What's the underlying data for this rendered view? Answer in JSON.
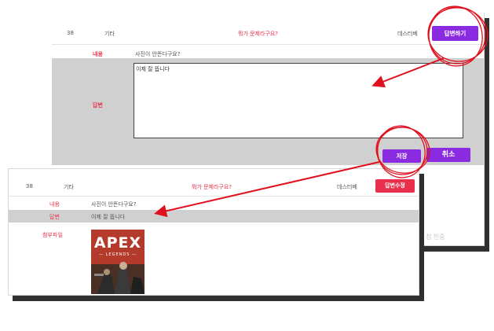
{
  "back_panel": {
    "row": {
      "num": "38",
      "category": "기타",
      "title": "뭐가 문제라구요?",
      "author": "데스터베",
      "answer_button": "답변하기"
    },
    "content_label": "내용",
    "content_value": "사진이 안뜬다구요?",
    "answer_label": "답변",
    "answer_value": "이제 잘 뜹니다",
    "save_button": "저장",
    "cancel_button": "취소",
    "faded_text": "첨 인증"
  },
  "front_panel": {
    "row": {
      "num": "38",
      "category": "기타",
      "title": "뭐가 문제라구요?",
      "author": "데스터베",
      "edit_button": "답변수정"
    },
    "content_label": "내용",
    "content_value": "사진이 안뜬다구요?",
    "answer_label": "답변",
    "answer_value": "이제 잘 뜹니다",
    "attachment_label": "첨부파일",
    "attachment_image": {
      "title": "APEX",
      "subtitle": "— LEGENDS —"
    }
  },
  "colors": {
    "accent_purple": "#8a2be2",
    "accent_red": "#ea2f4d",
    "annotation_red": "#e0101e"
  }
}
